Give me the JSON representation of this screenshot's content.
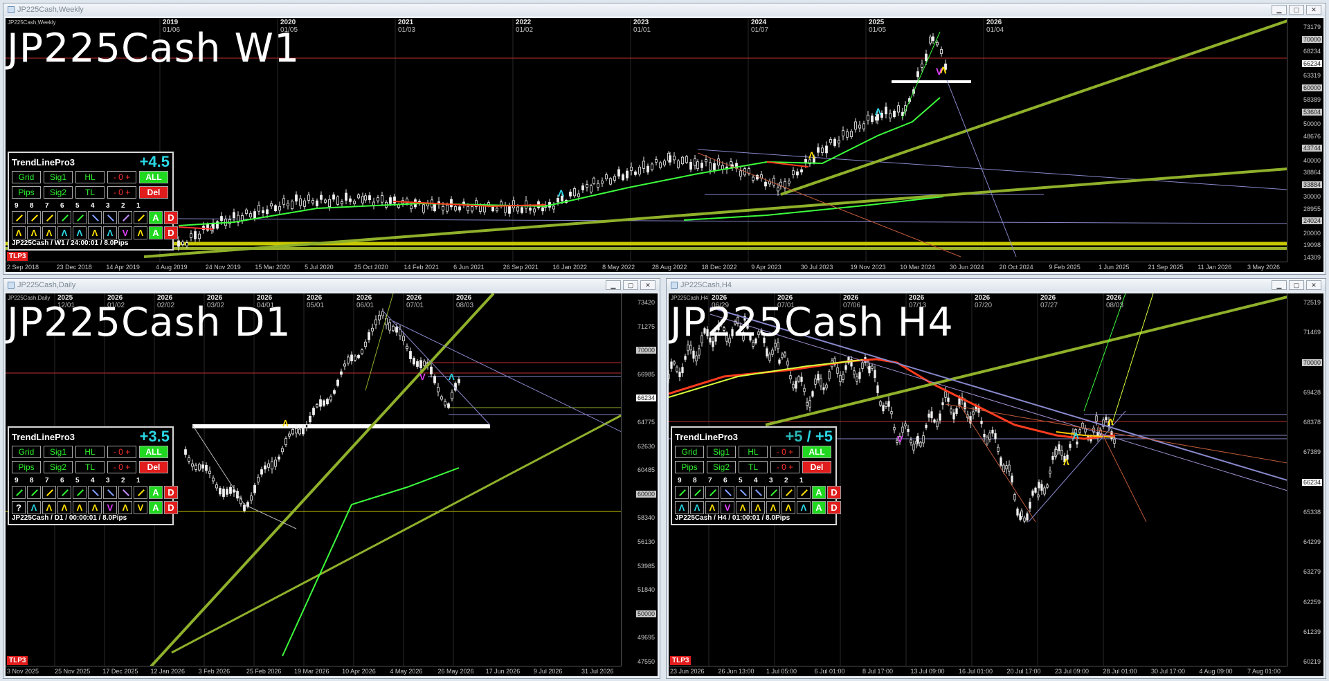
{
  "windows": {
    "weekly": {
      "title": "JP225Cash,Weekly",
      "chart_symbol": "JP225Cash,Weekly",
      "big_label": "JP225Cash  W1",
      "top_labels": [
        {
          "year": "2019",
          "date": "01/06"
        },
        {
          "year": "2020",
          "date": "01/05"
        },
        {
          "year": "2021",
          "date": "01/03"
        },
        {
          "year": "2022",
          "date": "01/02"
        },
        {
          "year": "2023",
          "date": "01/01"
        },
        {
          "year": "2024",
          "date": "01/07"
        },
        {
          "year": "2025",
          "date": "01/05"
        },
        {
          "year": "2026",
          "date": "01/04"
        }
      ],
      "y_labels": [
        "73179",
        "70000",
        "68234",
        "66234",
        "63319",
        "60000",
        "58389",
        "53604",
        "50000",
        "48676",
        "43744",
        "40000",
        "38864",
        "33884",
        "30000",
        "28955",
        "24024",
        "20000",
        "19098",
        "14309"
      ],
      "x_labels": [
        "2 Sep 2018",
        "23 Dec 2018",
        "14 Apr 2019",
        "4 Aug 2019",
        "24 Nov 2019",
        "15 Mar 2020",
        "5 Jul 2020",
        "25 Oct 2020",
        "14 Feb 2021",
        "6 Jun 2021",
        "26 Sep 2021",
        "16 Jan 2022",
        "8 May 2022",
        "28 Aug 2022",
        "18 Dec 2022",
        "9 Apr 2023",
        "30 Jul 2023",
        "19 Nov 2023",
        "10 Mar 2024",
        "30 Jun 2024",
        "20 Oct 2024",
        "9 Feb 2025",
        "1 Jun 2025",
        "21 Sep 2025",
        "11 Jan 2026",
        "3 May 2026"
      ],
      "tlp3": "TLP3",
      "panel": {
        "title": "TrendLinePro3",
        "value": "+4.5",
        "row1": [
          "Grid",
          "Sig1",
          "HL",
          "- 0 +",
          "ALL"
        ],
        "row2": [
          "Pips",
          "Sig2",
          "TL",
          "- 0 +",
          "Del"
        ],
        "numbers": [
          "9",
          "8",
          "7",
          "6",
          "5",
          "4",
          "3",
          "2",
          "1"
        ],
        "side1": [
          "A",
          "D"
        ],
        "row4": [
          "Λ",
          "Λ",
          "Λ",
          "Λ",
          "Λ",
          "Λ",
          "Λ",
          "V",
          "Λ"
        ],
        "side2": [
          "A",
          "D"
        ],
        "footer": "JP225Cash / W1 / 24:00:01 / 8.0Pips"
      }
    },
    "daily": {
      "title": "JP225Cash,Daily",
      "chart_symbol": "JP225Cash,Daily",
      "big_label": "JP225Cash  D1",
      "top_labels": [
        {
          "year": "2025",
          "date": "12/01"
        },
        {
          "year": "2026",
          "date": "01/02"
        },
        {
          "year": "2026",
          "date": "02/02"
        },
        {
          "year": "2026",
          "date": "03/02"
        },
        {
          "year": "2026",
          "date": "04/01"
        },
        {
          "year": "2026",
          "date": "05/01"
        },
        {
          "year": "2026",
          "date": "06/01"
        },
        {
          "year": "2026",
          "date": "07/01"
        },
        {
          "year": "2026",
          "date": "08/03"
        }
      ],
      "y_labels": [
        "73420",
        "71275",
        "70000",
        "66985",
        "66234",
        "64775",
        "62630",
        "60485",
        "60000",
        "58340",
        "56130",
        "53985",
        "51840",
        "50000",
        "49695",
        "47550"
      ],
      "x_labels": [
        "3 Nov 2025",
        "25 Nov 2025",
        "17 Dec 2025",
        "12 Jan 2026",
        "3 Feb 2026",
        "25 Feb 2026",
        "19 Mar 2026",
        "10 Apr 2026",
        "4 May 2026",
        "26 May 2026",
        "17 Jun 2026",
        "9 Jul 2026",
        "31 Jul 2026"
      ],
      "tlp3": "TLP3",
      "panel": {
        "title": "TrendLinePro3",
        "value": "+3.5",
        "row1": [
          "Grid",
          "Sig1",
          "HL",
          "- 0 +",
          "ALL"
        ],
        "row2": [
          "Pips",
          "Sig2",
          "TL",
          "- 0 +",
          "Del"
        ],
        "numbers": [
          "9",
          "8",
          "7",
          "6",
          "5",
          "4",
          "3",
          "2",
          "1"
        ],
        "side1": [
          "A",
          "D"
        ],
        "row4": [
          "?",
          "Λ",
          "Λ",
          "Λ",
          "Λ",
          "Λ",
          "V",
          "Λ",
          "V"
        ],
        "side2": [
          "A",
          "D"
        ],
        "footer": "JP225Cash / D1 / 00:00:01 / 8.0Pips"
      }
    },
    "h4": {
      "title": "JP225Cash,H4",
      "chart_symbol": "JP225Cash,H4",
      "big_label": "JP225Cash  H4",
      "top_labels": [
        {
          "year": "2026",
          "date": "06/29"
        },
        {
          "year": "2026",
          "date": "07/01"
        },
        {
          "year": "2026",
          "date": "07/06"
        },
        {
          "year": "2026",
          "date": "07/13"
        },
        {
          "year": "2026",
          "date": "07/20"
        },
        {
          "year": "2026",
          "date": "07/27"
        },
        {
          "year": "2026",
          "date": "08/03"
        }
      ],
      "y_labels": [
        "72519",
        "71469",
        "70000",
        "69428",
        "68378",
        "67389",
        "66234",
        "65338",
        "64299",
        "63279",
        "62259",
        "61239",
        "60219"
      ],
      "x_labels": [
        "23 Jun 2026",
        "26 Jun 13:00",
        "1 Jul 05:00",
        "6 Jul 01:00",
        "8 Jul 17:00",
        "13 Jul 09:00",
        "16 Jul 01:00",
        "20 Jul 17:00",
        "23 Jul 09:00",
        "28 Jul 01:00",
        "30 Jul 17:00",
        "4 Aug 09:00",
        "7 Aug 01:00"
      ],
      "tlp3": "TLP3",
      "panel": {
        "title": "TrendLinePro3",
        "value_a": "+5",
        "value_sep": "/",
        "value_b": "+5",
        "row1": [
          "Grid",
          "Sig1",
          "HL",
          "- 0 +",
          "ALL"
        ],
        "row2": [
          "Pips",
          "Sig2",
          "TL",
          "- 0 +",
          "Del"
        ],
        "numbers": [
          "9",
          "8",
          "7",
          "6",
          "5",
          "4",
          "3",
          "2",
          "1"
        ],
        "side1": [
          "A",
          "D"
        ],
        "row4": [
          "Λ",
          "Λ",
          "Λ",
          "V",
          "Λ",
          "Λ",
          "Λ",
          "Λ",
          "Λ"
        ],
        "side2": [
          "A",
          "D"
        ],
        "footer": "JP225Cash / H4 / 01:00:01 / 8.0Pips"
      }
    }
  }
}
